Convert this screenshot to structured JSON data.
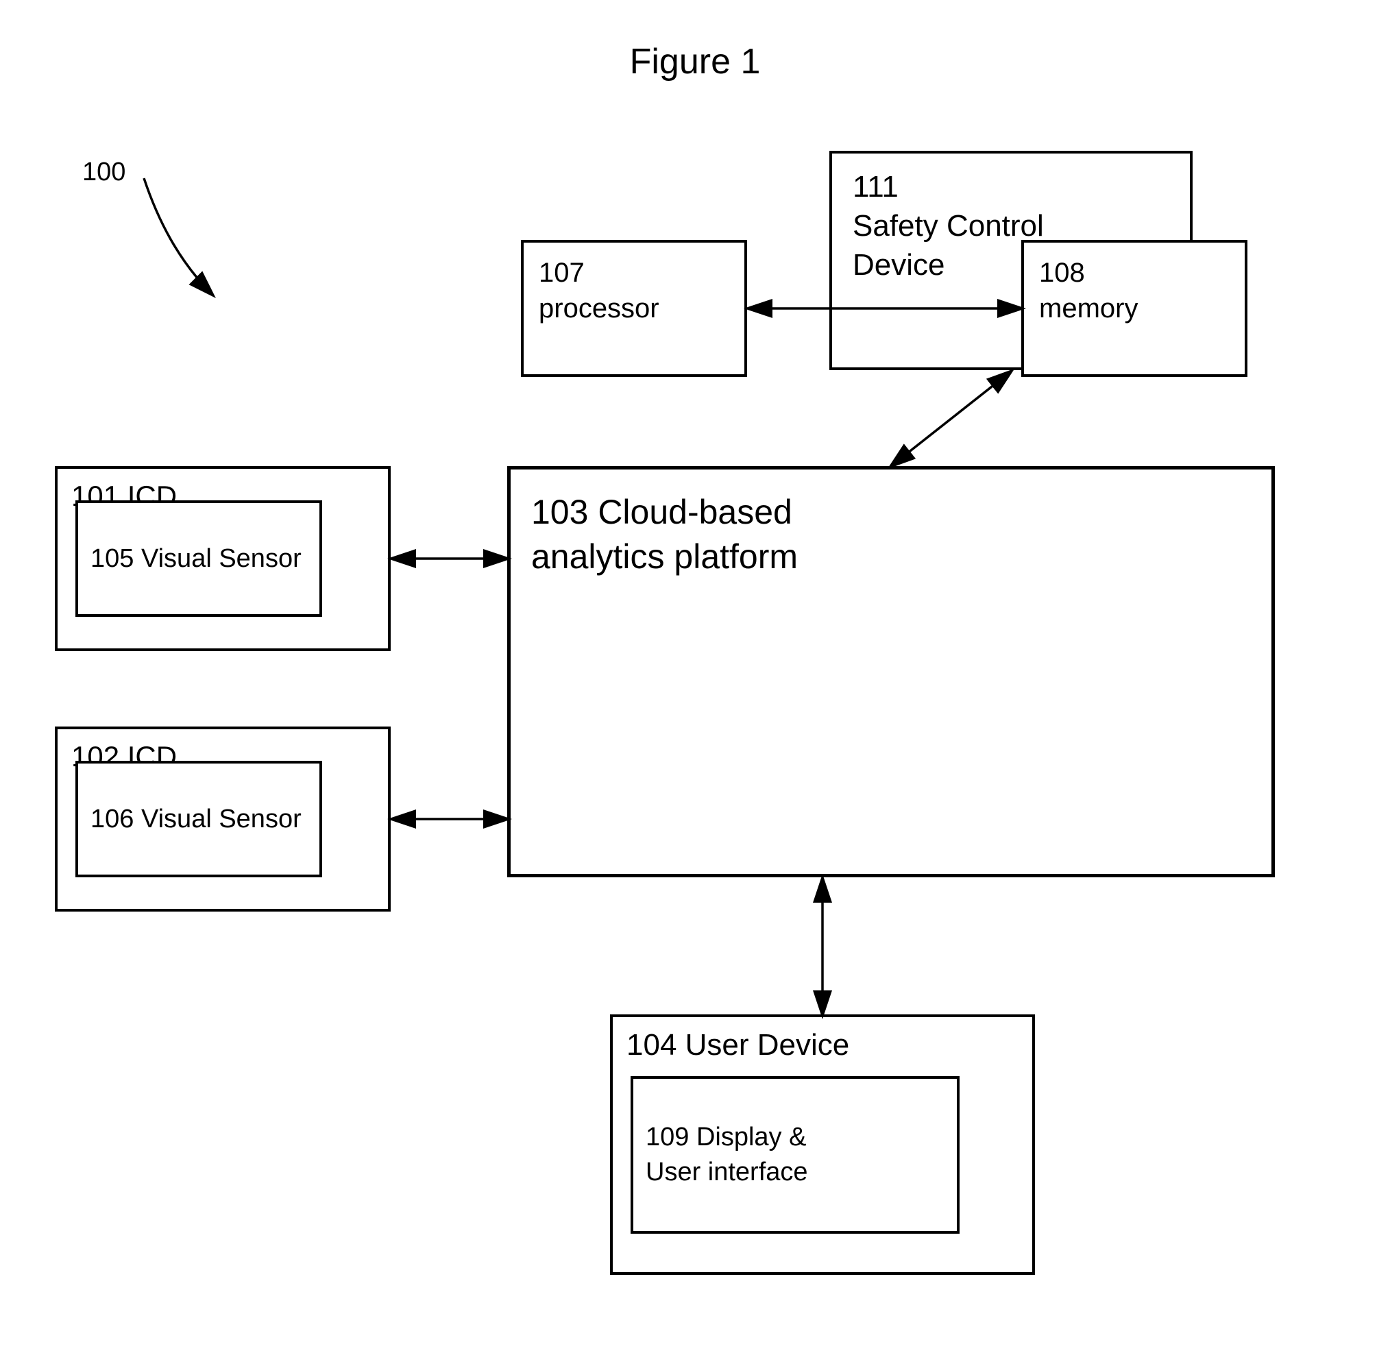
{
  "figure": {
    "title": "Figure 1"
  },
  "label100": "100",
  "boxes": {
    "box111": {
      "id": "111",
      "label": "Safety Control\nDevice"
    },
    "box103": {
      "id": "103",
      "label": "103 Cloud-based\nanalytics platform"
    },
    "box107": {
      "id": "107",
      "label": "107\nprocessor"
    },
    "box108": {
      "id": "108",
      "label": "108\nmemory"
    },
    "box101": {
      "id": "101",
      "label": "101 ICD"
    },
    "box105": {
      "id": "105",
      "label": "105 Visual Sensor"
    },
    "box102": {
      "id": "102",
      "label": "102 ICD"
    },
    "box106": {
      "id": "106",
      "label": "106 Visual Sensor"
    },
    "box104": {
      "id": "104",
      "label": "104 User Device"
    },
    "box109": {
      "id": "109",
      "label": "109 Display &\nUser interface"
    }
  }
}
